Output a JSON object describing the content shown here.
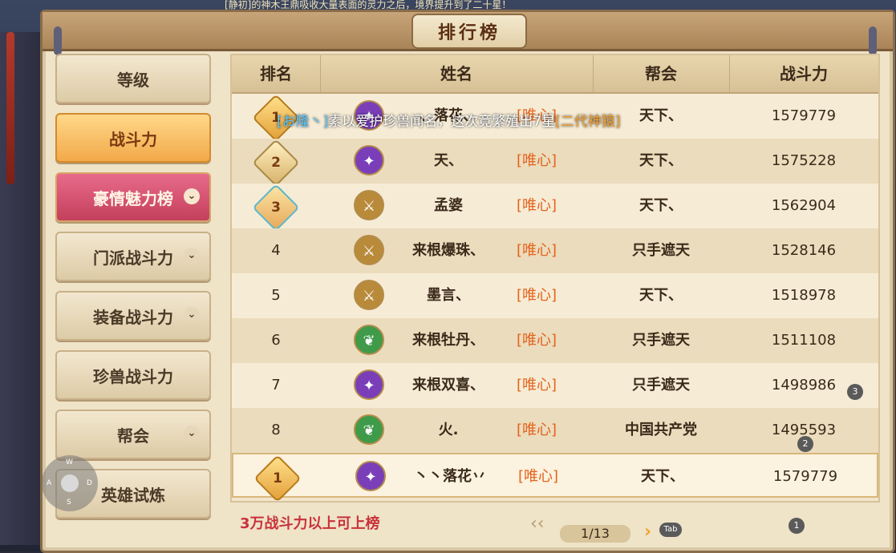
{
  "top_banner": "[静初]的神木王鼎吸收大量表面的灵力之后，境界提升到了二十星！",
  "window": {
    "title": "排行榜"
  },
  "sidebar": {
    "items": [
      {
        "label": "等级",
        "dropdown": false,
        "state": "normal"
      },
      {
        "label": "战斗力",
        "dropdown": false,
        "state": "active"
      },
      {
        "label": "豪情魅力榜",
        "dropdown": true,
        "state": "highlight"
      },
      {
        "label": "门派战斗力",
        "dropdown": true,
        "state": "normal"
      },
      {
        "label": "装备战斗力",
        "dropdown": true,
        "state": "normal"
      },
      {
        "label": "珍兽战斗力",
        "dropdown": false,
        "state": "normal"
      },
      {
        "label": "帮会",
        "dropdown": true,
        "state": "normal"
      },
      {
        "label": "英雄试炼",
        "dropdown": false,
        "state": "normal"
      }
    ],
    "chevron_glyph": "⌄"
  },
  "table": {
    "headers": {
      "rank": "排名",
      "name": "姓名",
      "guild": "帮会",
      "power": "战斗力"
    },
    "rows": [
      {
        "rank": "1",
        "medal": "gold",
        "icon": "sect-icon-purple",
        "name": "、落花、",
        "tag": "[唯心]",
        "guild": "天下、",
        "power": "1579779"
      },
      {
        "rank": "2",
        "medal": "silver",
        "icon": "sect-icon-purple",
        "name": "天、",
        "tag": "[唯心]",
        "guild": "天下、",
        "power": "1575228"
      },
      {
        "rank": "3",
        "medal": "bronze",
        "icon": "sect-icon-gold",
        "name": "孟婆",
        "tag": "[唯心]",
        "guild": "天下、",
        "power": "1562904"
      },
      {
        "rank": "4",
        "medal": "",
        "icon": "sect-icon-gold",
        "name": "来根爆珠、",
        "tag": "[唯心]",
        "guild": "只手遮天",
        "power": "1528146"
      },
      {
        "rank": "5",
        "medal": "",
        "icon": "sect-icon-gold",
        "name": "墨言、",
        "tag": "[唯心]",
        "guild": "天下、",
        "power": "1518978"
      },
      {
        "rank": "6",
        "medal": "",
        "icon": "sect-icon-green",
        "name": "来根牡丹、",
        "tag": "[唯心]",
        "guild": "只手遮天",
        "power": "1511108"
      },
      {
        "rank": "7",
        "medal": "",
        "icon": "sect-icon-purple",
        "name": "来根双喜、",
        "tag": "[唯心]",
        "guild": "只手遮天",
        "power": "1498986"
      },
      {
        "rank": "8",
        "medal": "",
        "icon": "sect-icon-green",
        "name": "火.",
        "tag": "[唯心]",
        "guild": "中国共产党",
        "power": "1495593"
      }
    ],
    "self_row": {
      "rank": "1",
      "medal": "gold",
      "icon": "sect-icon-purple",
      "name": "丶丶落花丷",
      "tag": "[唯心]",
      "guild": "天下、",
      "power": "1579779"
    }
  },
  "announcement": {
    "prefix": "[お隆丶]",
    "text": "素以爱护珍兽闻名，这次竟繁殖出7星",
    "item": "[二代神猿]"
  },
  "footer": {
    "requirement": "3万战斗力以上可上榜",
    "page": "1/13",
    "prev_glyph": "‹‹",
    "next_glyph": "›"
  },
  "hud": {
    "joystick": {
      "n": "W",
      "w": "A",
      "e": "D",
      "s": "S"
    },
    "tab_label": "Tab",
    "badges": [
      "3",
      "2",
      "1"
    ]
  },
  "colors": {
    "accent": "#f2a949",
    "tag": "#e4631d",
    "requirement": "#c8323a"
  }
}
